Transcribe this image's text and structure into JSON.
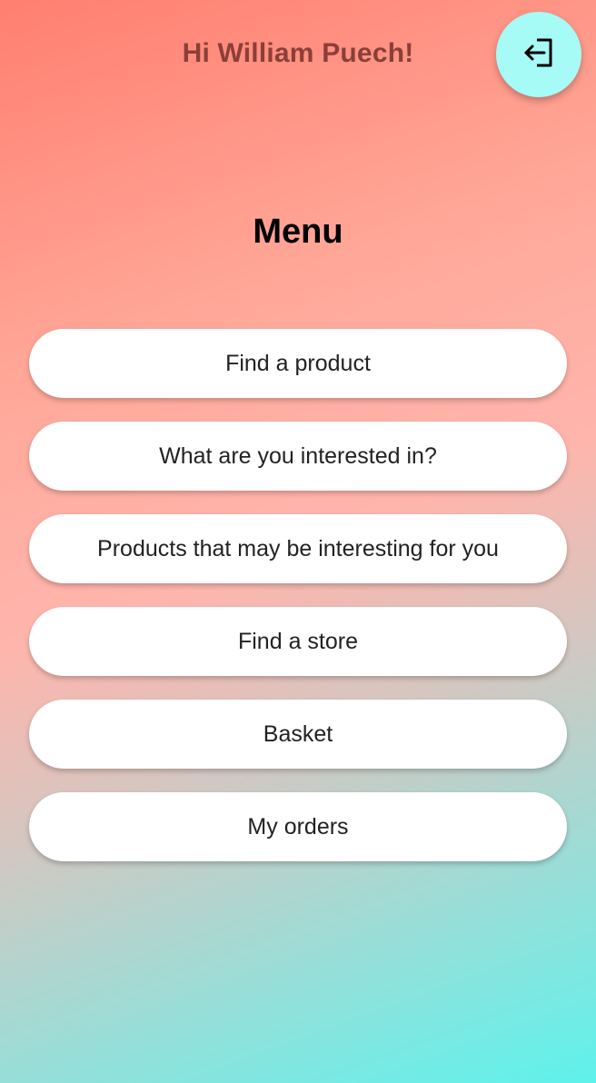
{
  "header": {
    "greeting": "Hi William Puech!",
    "logout_icon": "logout-icon"
  },
  "menu": {
    "title": "Menu",
    "items": [
      {
        "label": "Find a product"
      },
      {
        "label": "What are you interested in?"
      },
      {
        "label": "Products that may be interesting for you"
      },
      {
        "label": "Find a store"
      },
      {
        "label": "Basket"
      },
      {
        "label": "My orders"
      }
    ]
  },
  "colors": {
    "gradient_top": "#ff7f70",
    "gradient_mid": "#ffb5ac",
    "gradient_bottom": "#5ef2ec",
    "greeting_text": "#8a3f38",
    "logout_button_bg": "#a6fbf7",
    "menu_button_bg": "#ffffff"
  }
}
